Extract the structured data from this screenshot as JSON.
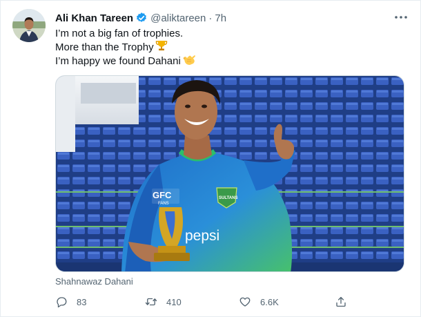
{
  "tweet": {
    "author_name": "Ali Khan Tareen",
    "handle": "@aliktareen",
    "separator": "·",
    "time": "7h",
    "verified": true,
    "lines": [
      {
        "text": "I’m not a big fan of trophies.",
        "emoji": ""
      },
      {
        "text": "More than the Trophy",
        "emoji": "trophy"
      },
      {
        "text": "I’m happy we found Dahani ",
        "emoji": "call-me-hand"
      }
    ],
    "media_caption": "Shahnawaz Dahani",
    "media_text": {
      "sponsor": "GFC",
      "sponsor_sub": "FANS",
      "team": "SULTANS",
      "brand": "pepsi"
    },
    "stats": {
      "replies": "83",
      "retweets": "410",
      "likes": "6.6K"
    },
    "accent": "#1d9bf0",
    "muted": "#536471"
  }
}
